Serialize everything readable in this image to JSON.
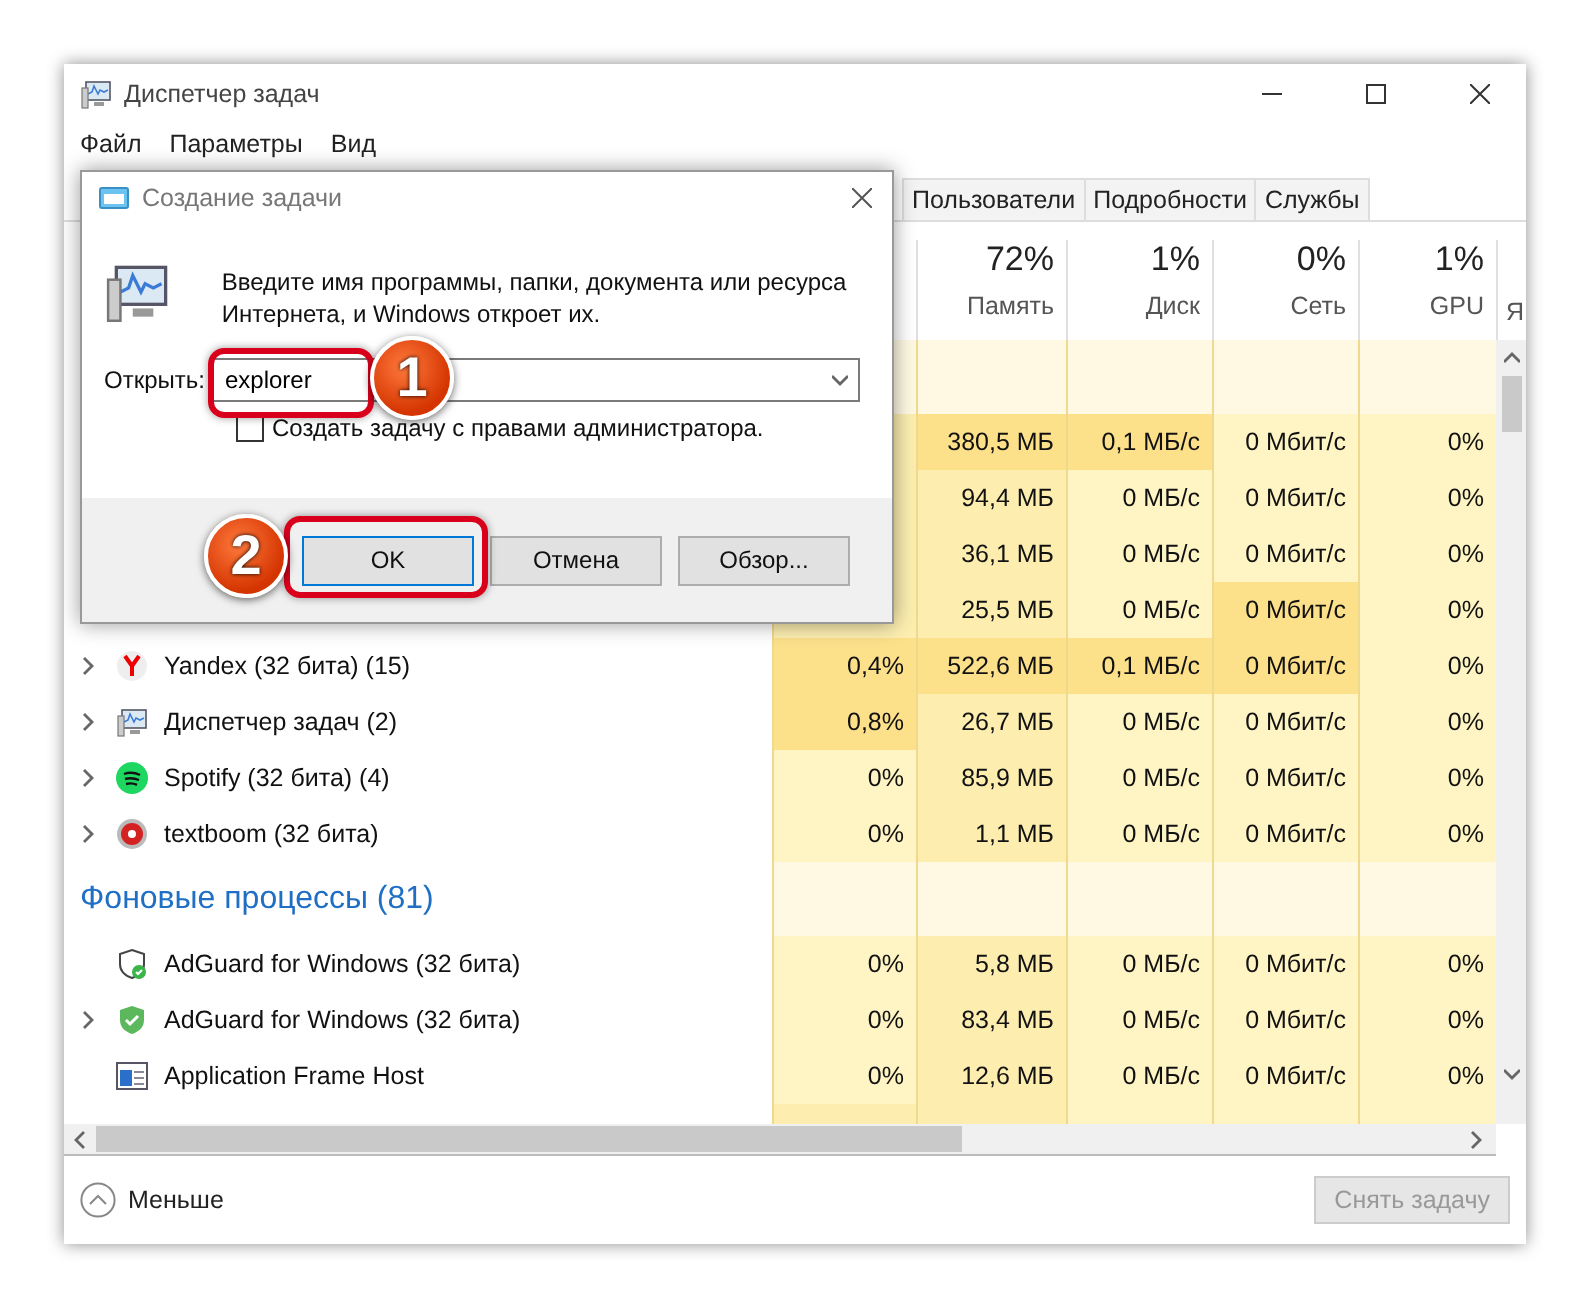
{
  "window": {
    "title": "Диспетчер задач"
  },
  "menu": [
    "Файл",
    "Параметры",
    "Вид"
  ],
  "tabs": [
    {
      "label": "Пользователи",
      "selected": false
    },
    {
      "label": "Подробности",
      "selected": false
    },
    {
      "label": "Службы",
      "selected": false
    }
  ],
  "columns": [
    {
      "value": "72%",
      "label": "Память"
    },
    {
      "value": "1%",
      "label": "Диск"
    },
    {
      "value": "0%",
      "label": "Сеть"
    },
    {
      "value": "1%",
      "label": "GPU"
    }
  ],
  "column_7": "Я",
  "rows": [
    {
      "kind": "process",
      "cells": [
        {
          "text": "380,5 МБ",
          "hot": true
        },
        {
          "text": "0,1 МБ/с",
          "hot": true
        },
        {
          "text": "0 Мбит/с",
          "hot": false
        },
        {
          "text": "0%",
          "hot": false
        }
      ]
    },
    {
      "kind": "process",
      "cells": [
        {
          "text": "94,4 МБ",
          "hot": false
        },
        {
          "text": "0 МБ/с",
          "hot": false
        },
        {
          "text": "0 Мбит/с",
          "hot": false
        },
        {
          "text": "0%",
          "hot": false
        }
      ]
    },
    {
      "kind": "process",
      "cells": [
        {
          "text": "36,1 МБ",
          "hot": false
        },
        {
          "text": "0 МБ/с",
          "hot": false
        },
        {
          "text": "0 Мбит/с",
          "hot": false
        },
        {
          "text": "0%",
          "hot": false
        }
      ]
    },
    {
      "kind": "process",
      "cells": [
        {
          "text": "25,5 МБ",
          "hot": false
        },
        {
          "text": "0 МБ/с",
          "hot": false
        },
        {
          "text": "0 Мбит/с",
          "hot": true
        },
        {
          "text": "0%",
          "hot": false
        }
      ]
    },
    {
      "kind": "process",
      "name": "Yandex (32 бита) (15)",
      "expandable": true,
      "cpu": {
        "text": "0,4%",
        "hot": true
      },
      "cells": [
        {
          "text": "522,6 МБ",
          "hot": true
        },
        {
          "text": "0,1 МБ/с",
          "hot": true
        },
        {
          "text": "0 Мбит/с",
          "hot": true
        },
        {
          "text": "0%",
          "hot": false
        }
      ]
    },
    {
      "kind": "process",
      "name": "Диспетчер задач (2)",
      "expandable": true,
      "cpu": {
        "text": "0,8%",
        "hot": true
      },
      "cells": [
        {
          "text": "26,7 МБ",
          "hot": false
        },
        {
          "text": "0 МБ/с",
          "hot": false
        },
        {
          "text": "0 Мбит/с",
          "hot": false
        },
        {
          "text": "0%",
          "hot": false
        }
      ]
    },
    {
      "kind": "process",
      "name": "Spotify (32 бита) (4)",
      "expandable": true,
      "cpu": {
        "text": "0%",
        "hot": false
      },
      "cells": [
        {
          "text": "85,9 МБ",
          "hot": false
        },
        {
          "text": "0 МБ/с",
          "hot": false
        },
        {
          "text": "0 Мбит/с",
          "hot": false
        },
        {
          "text": "0%",
          "hot": false
        }
      ]
    },
    {
      "kind": "process",
      "name": "textboom (32 бита)",
      "expandable": true,
      "cpu": {
        "text": "0%",
        "hot": false
      },
      "cells": [
        {
          "text": "1,1 МБ",
          "hot": false
        },
        {
          "text": "0 МБ/с",
          "hot": false
        },
        {
          "text": "0 Мбит/с",
          "hot": false
        },
        {
          "text": "0%",
          "hot": false
        }
      ]
    },
    {
      "kind": "section",
      "name": "Фоновые процессы (81)"
    },
    {
      "kind": "process",
      "name": "AdGuard for Windows (32 бита)",
      "expandable": false,
      "cpu": {
        "text": "0%",
        "hot": false
      },
      "cells": [
        {
          "text": "5,8 МБ",
          "hot": false
        },
        {
          "text": "0 МБ/с",
          "hot": false
        },
        {
          "text": "0 Мбит/с",
          "hot": false
        },
        {
          "text": "0%",
          "hot": false
        }
      ]
    },
    {
      "kind": "process",
      "name": "AdGuard for Windows (32 бита)",
      "expandable": true,
      "cpu": {
        "text": "0%",
        "hot": false
      },
      "cells": [
        {
          "text": "83,4 МБ",
          "hot": false
        },
        {
          "text": "0 МБ/с",
          "hot": false
        },
        {
          "text": "0 Мбит/с",
          "hot": false
        },
        {
          "text": "0%",
          "hot": false
        }
      ]
    },
    {
      "kind": "process",
      "name": "Application Frame Host",
      "expandable": false,
      "cpu": {
        "text": "0%",
        "hot": false
      },
      "cells": [
        {
          "text": "12,6 МБ",
          "hot": false
        },
        {
          "text": "0 МБ/с",
          "hot": false
        },
        {
          "text": "0 Мбит/с",
          "hot": false
        },
        {
          "text": "0%",
          "hot": false
        }
      ]
    }
  ],
  "footer": {
    "less": "Меньше",
    "end_task": {
      "label": "Снять задачу",
      "disabled": true
    }
  },
  "dialog": {
    "title": "Создание задачи",
    "description": "Введите имя программы, папки, документа или ресурса Интернета, и Windows откроет их.",
    "open_label": "Открыть:",
    "open_value": "explorer",
    "admin": {
      "label": "Создать задачу с правами администратора.",
      "checked": false
    },
    "buttons": [
      "OK",
      "Отмена",
      "Обзор..."
    ]
  },
  "annotations": [
    "1",
    "2"
  ]
}
